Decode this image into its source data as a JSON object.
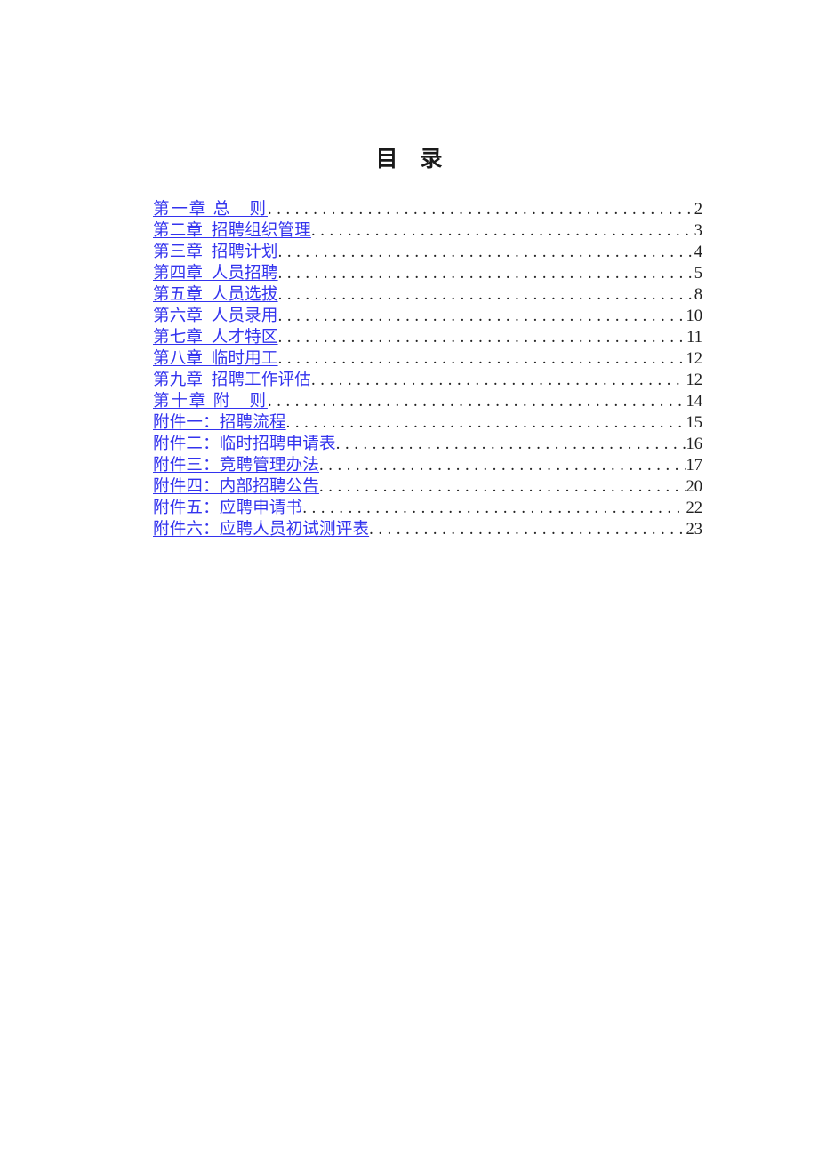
{
  "document": {
    "title": "目　录",
    "link_color": "#3333ee",
    "leader_color": "#202020",
    "title_color": "#1a1a1a",
    "background": "#ffffff"
  },
  "toc": {
    "entries": [
      {
        "label": "第一章 总　则",
        "page": "2",
        "spaced": true
      },
      {
        "label": "第二章  招聘组织管理",
        "page": "3",
        "spaced": false
      },
      {
        "label": "第三章  招聘计划",
        "page": "4",
        "spaced": false
      },
      {
        "label": "第四章  人员招聘",
        "page": "5",
        "spaced": false
      },
      {
        "label": "第五章  人员选拔",
        "page": "8",
        "spaced": false
      },
      {
        "label": "第六章  人员录用",
        "page": "10",
        "spaced": false
      },
      {
        "label": "第七章  人才特区",
        "page": "11",
        "spaced": false
      },
      {
        "label": "第八章  临时用工",
        "page": "12",
        "spaced": false
      },
      {
        "label": "第九章  招聘工作评估",
        "page": "12",
        "spaced": false
      },
      {
        "label": "第十章 附　则",
        "page": "14",
        "spaced": true
      },
      {
        "label": "附件一：招聘流程",
        "page": "15",
        "spaced": false
      },
      {
        "label": "附件二：临时招聘申请表",
        "page": "16",
        "spaced": false
      },
      {
        "label": "附件三：竞聘管理办法",
        "page": "17",
        "spaced": false
      },
      {
        "label": "附件四：内部招聘公告",
        "page": "20",
        "spaced": false
      },
      {
        "label": "附件五：应聘申请书",
        "page": "22",
        "spaced": false
      },
      {
        "label": "附件六：应聘人员初试测评表",
        "page": "23",
        "spaced": false
      }
    ]
  }
}
